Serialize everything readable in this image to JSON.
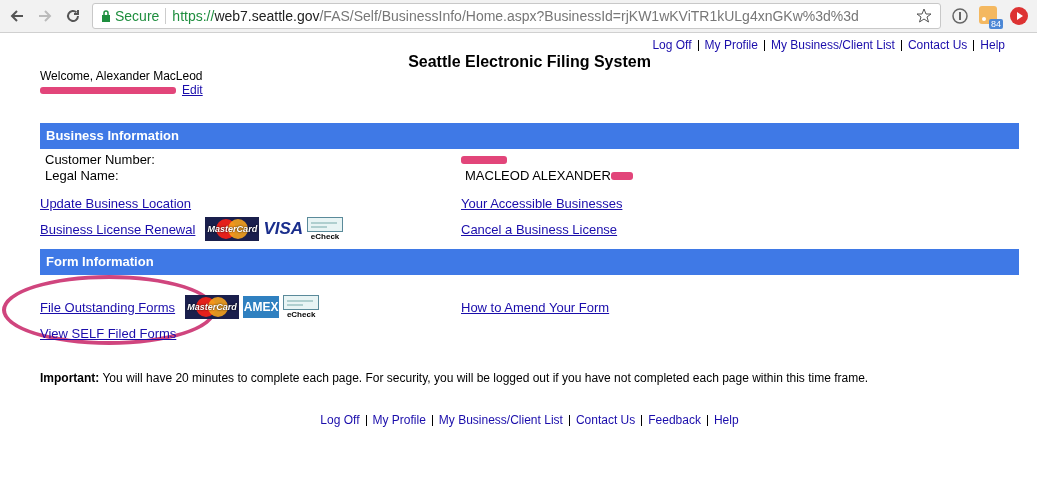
{
  "browser": {
    "secure_label": "Secure",
    "url_scheme": "https://",
    "url_host": "web7.seattle.gov",
    "url_path": "/FAS/Self/BusinessInfo/Home.aspx?BusinessId=rjKW1wKViTR1kULg4xnGKw%3d%3d",
    "extension_badge": "84"
  },
  "top_links": [
    "Log Off",
    "My Profile",
    "My Business/Client List",
    "Contact Us",
    "Help"
  ],
  "page_title": "Seattle Electronic Filing System",
  "welcome": "Welcome, Alexander MacLeod",
  "edit_link": "Edit",
  "sections": [
    {
      "title": "Business Information",
      "fields": [
        {
          "label": "Customer Number:"
        },
        {
          "label": "Legal Name:",
          "value": "MACLEOD ALEXANDER"
        }
      ],
      "rows": [
        {
          "left": "Update Business Location",
          "payments": [],
          "right": "Your Accessible Businesses"
        },
        {
          "left": "Business License Renewal",
          "payments": [
            {
              "kind": "mastercard",
              "label": "MasterCard"
            },
            {
              "kind": "visa",
              "label": "VISA"
            },
            {
              "kind": "echeck",
              "label": "eCheck"
            }
          ],
          "right": "Cancel a Business License"
        }
      ]
    },
    {
      "title": "Form Information",
      "rows": [
        {
          "left": "File Outstanding Forms",
          "payments": [
            {
              "kind": "mastercard",
              "label": "MasterCard"
            },
            {
              "kind": "amex",
              "label": "AMEX"
            },
            {
              "kind": "echeck",
              "label": "eCheck"
            }
          ],
          "right": "How to Amend Your Form",
          "circled": true
        },
        {
          "left": "View SELF Filed Forms",
          "payments": []
        }
      ]
    }
  ],
  "notice": "**Important:** You will have 20 minutes to complete each page. For security, you will be logged out if you have not completed each page within this time frame.",
  "footer_links": [
    "Log Off",
    "My Profile",
    "My Business/Client List",
    "Contact Us",
    "Feedback",
    "Help"
  ]
}
